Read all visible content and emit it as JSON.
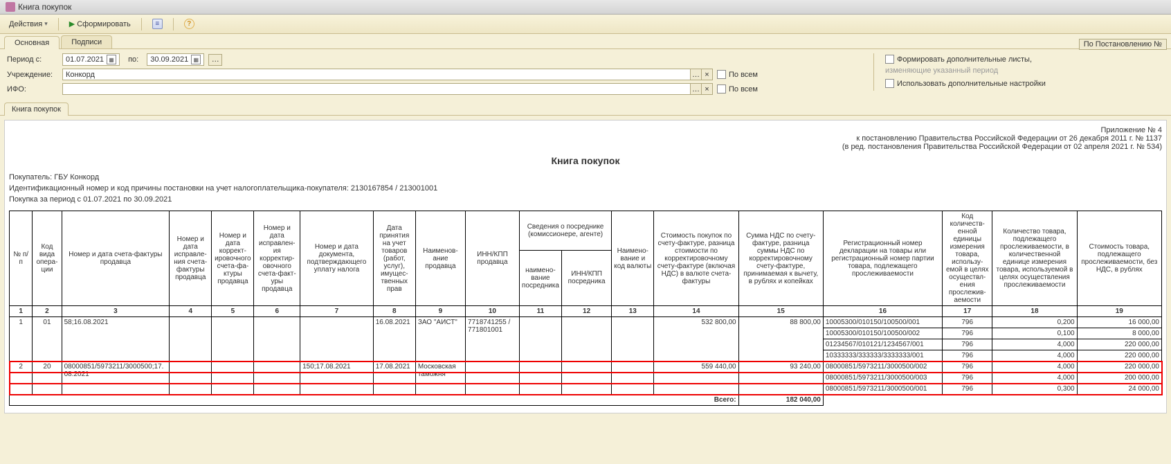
{
  "window": {
    "title": "Книга покупок"
  },
  "toolbar": {
    "actions": "Действия",
    "form": "Сформировать",
    "help": "?"
  },
  "tabs": {
    "main": "Основная",
    "signs": "Подписи",
    "decree": "По Постановлению №"
  },
  "filters": {
    "period_label": "Период с:",
    "from": "01.07.2021",
    "to_label": "по:",
    "to": "30.09.2021",
    "org_label": "Учреждение:",
    "org": "Конкорд",
    "ifo_label": "ИФО:",
    "ifo": "",
    "all": "По всем",
    "form_extra": "Формировать дополнительные листы,",
    "changing": "изменяющие указанный период",
    "use_extra": "Использовать дополнительные настройки"
  },
  "inner_tab": "Книга покупок",
  "report": {
    "annex": "Приложение № 4",
    "annex2": "к постановлению Правительства Российской Федерации от 26 декабря 2011 г. № 1137",
    "annex3": "(в ред. постановления Правительства Российской Федерации от 02 апреля 2021 г. № 534)",
    "title": "Книга покупок",
    "buyer": "Покупатель: ГБУ Конкорд",
    "inn": "Идентификационный номер и код причины постановки на учет налогоплательщика-покупателя:  2130167854 / 213001001",
    "period": "Покупка за период с 01.07.2021 по 30.09.2021"
  },
  "headers": {
    "c1": "№ п/п",
    "c2": "Код вида опера­ции",
    "c3": "Номер и дата счета-фактуры продавца",
    "c4": "Номер и дата исправле­ния счета-фак­туры продавца",
    "c5": "Номер и дата коррект­ировоч­ного счета-фа­ктуры продавца",
    "c6": "Номер и дата исправлен­ия корректир­овоч­ного счета-факт­уры продавца",
    "c7": "Номер и дата документа, подтверждаю­щего уплату налога",
    "c8": "Дата принятия на учет товаров (работ, услуг), имущес­твен­ных прав",
    "c9": "Наименов­ание продавца",
    "c10": "ИНН/КПП продавца",
    "c11g": "Сведения о посреднике (комиссионере, агенте)",
    "c11": "наимено­ва­ние посредн­ика",
    "c12": "ИНН/КПП посредника",
    "c13": "Наимено-вание и код валюты",
    "c14": "Стоимость покупок по счету-фактуре, разница стоимости по корректировочному счету-фактуре (включая НДС) в валюте счета-фактуры",
    "c15": "Сумма НДС по счету-фактуре, разница суммы НДС по корректировочному счету-фактуре, принимаемая к вычету, в рублях и копейках",
    "c16": "Регистрационный номер декларации на товары или регистрационный номер партии товара, подлежащего прослеживаемости",
    "c17": "Код количеств­енной единицы измерения товара, использу­емой в целях осуществл­ения прослежив­аемости",
    "c18": "Количество товара, подлежащего прослеживаемости, в количественной единице измерения товара, используемой в целях осуществления прослеживаемости",
    "c19": "Стоимость товара, подлежащего прослеживаемости, без НДС, в рублях"
  },
  "colnums": [
    "1",
    "2",
    "3",
    "4",
    "5",
    "6",
    "7",
    "8",
    "9",
    "10",
    "11",
    "12",
    "13",
    "14",
    "15",
    "16",
    "17",
    "18",
    "19"
  ],
  "rows": [
    {
      "n": "1",
      "op": "01",
      "sf": "58;16.08.2021",
      "c4": "",
      "c5": "",
      "c6": "",
      "pay": "",
      "acc": "16.08.2021",
      "seller": "ЗАО \"АИСТ\"",
      "inn": "7718741255 / 771801001",
      "c11": "",
      "c12": "",
      "c13": "",
      "cost": "532 800,00",
      "vat": "88 800,00",
      "sub": [
        {
          "reg": "10005300/010150/100500/001",
          "u": "796",
          "q": "0,200",
          "s": "16 000,00"
        },
        {
          "reg": "10005300/010150/100500/002",
          "u": "796",
          "q": "0,100",
          "s": "8 000,00"
        },
        {
          "reg": "01234567/010121/1234567/001",
          "u": "796",
          "q": "4,000",
          "s": "220 000,00"
        },
        {
          "reg": "10333333/333333/3333333/001",
          "u": "796",
          "q": "4,000",
          "s": "220 000,00"
        }
      ]
    },
    {
      "n": "2",
      "op": "20",
      "sf": "08000851/5973211/3000500;17.08.2021",
      "c4": "",
      "c5": "",
      "c6": "",
      "pay": "150;17.08.2021",
      "acc": "17.08.2021",
      "seller": "Московская таможня",
      "inn": "",
      "c11": "",
      "c12": "",
      "c13": "",
      "cost": "559 440,00",
      "vat": "93 240,00",
      "hl": true,
      "sub": [
        {
          "reg": "08000851/5973211/3000500/002",
          "u": "796",
          "q": "4,000",
          "s": "220 000,00"
        },
        {
          "reg": "08000851/5973211/3000500/003",
          "u": "796",
          "q": "4,000",
          "s": "200 000,00"
        },
        {
          "reg": "08000851/5973211/3000500/001",
          "u": "796",
          "q": "0,300",
          "s": "24 000,00"
        }
      ]
    }
  ],
  "total": {
    "label": "Всего:",
    "vat": "182 040,00"
  }
}
